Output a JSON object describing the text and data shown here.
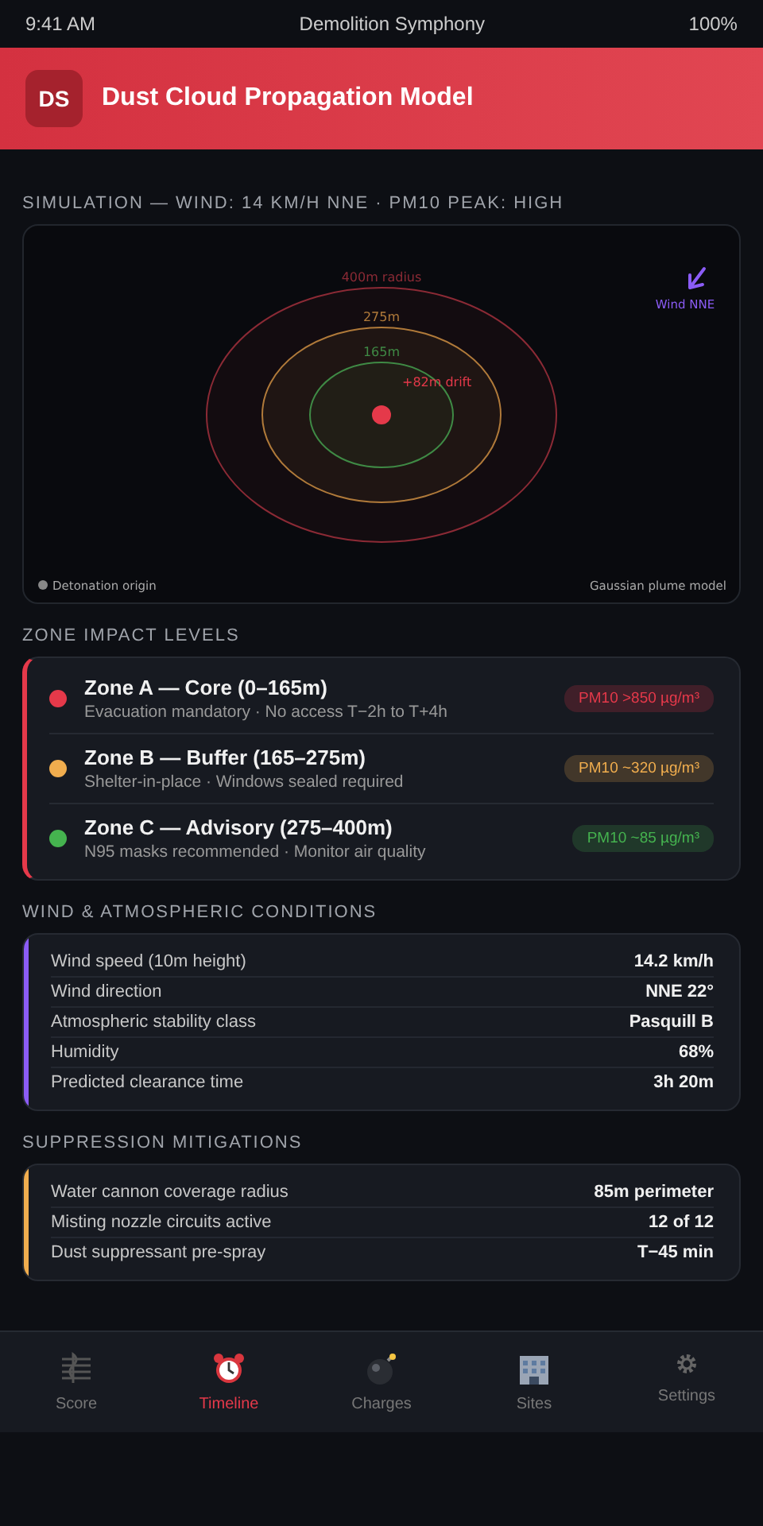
{
  "status_bar": {
    "time": "9:41 AM",
    "title": "Demolition Symphony",
    "battery": "100%"
  },
  "header": {
    "badge": "DS",
    "title": "Dust Cloud Propagation Model"
  },
  "simulation": {
    "heading": "SIMULATION — WIND: 14 KM/H NNE · PM10 PEAK: HIGH",
    "rings": [
      {
        "label": "400m radius",
        "color": "#8b2a35"
      },
      {
        "label": "275m",
        "color": "#b07a3a"
      },
      {
        "label": "165m",
        "color": "#3f8a45"
      }
    ],
    "drift_label": "+82m drift",
    "wind_label": "Wind NNE",
    "legend": "Detonation origin",
    "model": "Gaussian plume model"
  },
  "zones": {
    "heading": "ZONE IMPACT LEVELS",
    "items": [
      {
        "name": "Zone A — Core (0–165m)",
        "detail": "Evacuation mandatory · No access T−2h to T+4h",
        "reading": "PM10 >850 µg/m³",
        "color": "#e5394a"
      },
      {
        "name": "Zone B — Buffer (165–275m)",
        "detail": "Shelter-in-place · Windows sealed required",
        "reading": "PM10 ~320 µg/m³",
        "color": "#f0ad4e"
      },
      {
        "name": "Zone C — Advisory (275–400m)",
        "detail": "N95 masks recommended · Monitor air quality",
        "reading": "PM10 ~85 µg/m³",
        "color": "#45b34f"
      }
    ]
  },
  "conditions": {
    "heading": "WIND & ATMOSPHERIC CONDITIONS",
    "color": "#8b5cf6",
    "rows": [
      {
        "label": "Wind speed (10m height)",
        "value": "14.2 km/h"
      },
      {
        "label": "Wind direction",
        "value": "NNE 22°"
      },
      {
        "label": "Atmospheric stability class",
        "value": "Pasquill B"
      },
      {
        "label": "Humidity",
        "value": "68%"
      },
      {
        "label": "Predicted clearance time",
        "value": "3h 20m"
      }
    ]
  },
  "mitigations": {
    "heading": "SUPPRESSION MITIGATIONS",
    "color": "#f0ad4e",
    "rows": [
      {
        "label": "Water cannon coverage radius",
        "value": "85m perimeter"
      },
      {
        "label": "Misting nozzle circuits active",
        "value": "12 of 12"
      },
      {
        "label": "Dust suppressant pre-spray",
        "value": "T−45 min"
      }
    ]
  },
  "tabs": [
    {
      "label": "Score",
      "kind": "score",
      "selected": false
    },
    {
      "label": "Timeline",
      "kind": "clock",
      "selected": true
    },
    {
      "label": "Charges",
      "kind": "bomb",
      "selected": false
    },
    {
      "label": "Sites",
      "kind": "building",
      "selected": false
    },
    {
      "label": "Settings",
      "kind": "gear",
      "selected": false
    }
  ]
}
